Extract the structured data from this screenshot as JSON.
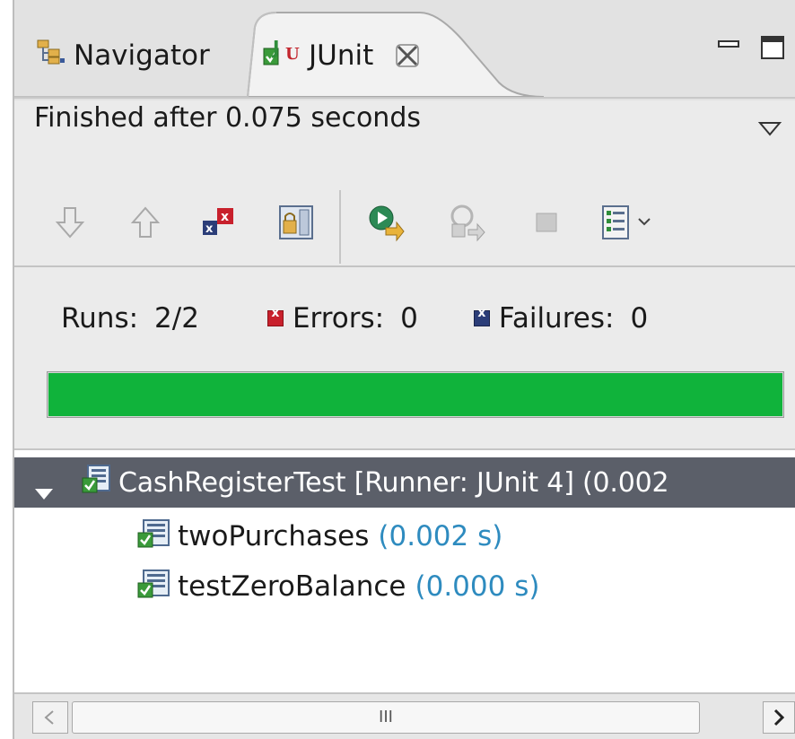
{
  "tabs": {
    "navigator": {
      "label": "Navigator",
      "icon": "navigator-icon"
    },
    "junit": {
      "label": "JUnit",
      "icon": "junit-icon",
      "close_icon": "close-icon"
    }
  },
  "window_controls": [
    "minimize-icon",
    "maximize-icon"
  ],
  "status": {
    "text": "Finished after 0.075 seconds"
  },
  "toolbar": {
    "buttons": [
      "next-failure-icon",
      "previous-failure-icon",
      "show-failures-only-icon",
      "scroll-lock-icon",
      "rerun-test-icon",
      "rerun-failed-first-icon",
      "stop-icon",
      "test-run-history-icon"
    ]
  },
  "counters": {
    "runs_label": "Runs:",
    "runs_value": "2/2",
    "errors_label": "Errors:",
    "errors_value": "0",
    "failures_label": "Failures:",
    "failures_value": "0"
  },
  "progress": {
    "fraction": 1.0,
    "color": "#10b33b"
  },
  "tree": {
    "root": {
      "label": "CashRegisterTest [Runner: JUnit 4] (0.002"
    },
    "items": [
      {
        "name": "twoPurchases",
        "time": "(0.002 s)"
      },
      {
        "name": "testZeroBalance",
        "time": "(0.000 s)"
      }
    ]
  },
  "scrollbar": {
    "grip": "III"
  },
  "colors": {
    "success": "#10b33b",
    "error": "#c8202c",
    "failure": "#2b3d78",
    "selected_row": "#5b5f69",
    "time_text": "#2e8bbf"
  }
}
